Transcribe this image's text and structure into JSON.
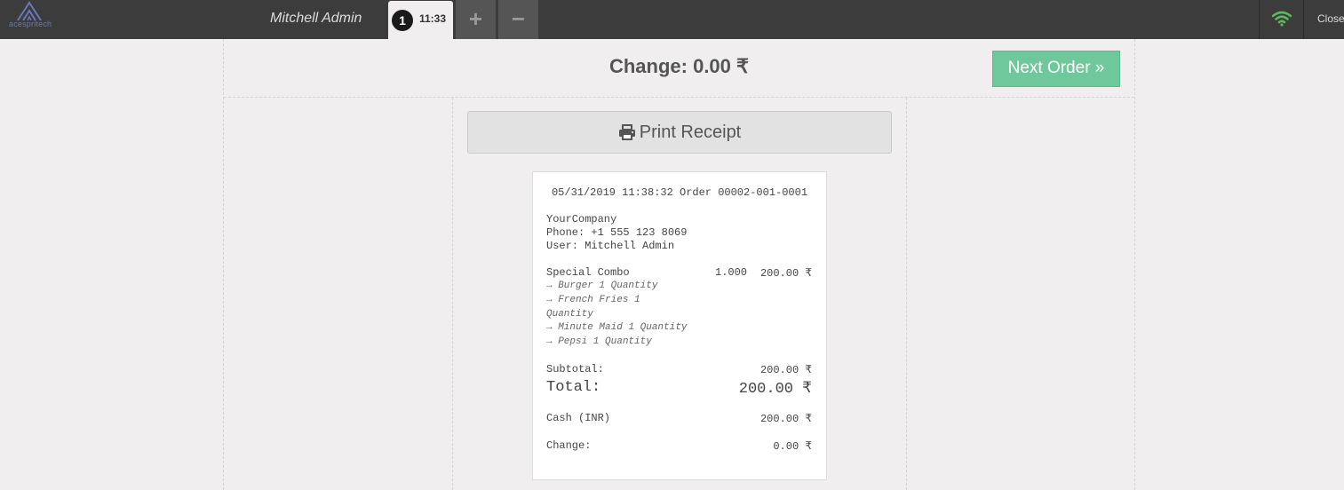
{
  "header": {
    "logo_text": "acespritech",
    "user_name": "Mitchell Admin",
    "order_tab": {
      "number": "1",
      "time": "11:33"
    },
    "add_order_label": "+",
    "remove_order_label": "−",
    "close_label": "Close",
    "wifi_icon": "wifi-icon",
    "wifi_color": "#5cb85c"
  },
  "screen": {
    "change_title": "Change: 0.00 ₹",
    "next_order_label": "Next Order »",
    "print_label": "Print Receipt",
    "print_icon": "printer-icon"
  },
  "receipt": {
    "header_line": "05/31/2019 11:38:32 Order 00002-001-0001",
    "company": "YourCompany",
    "phone": "Phone: +1 555 123 8069",
    "user": "User: Mitchell Admin",
    "line_item": {
      "name": "Special Combo",
      "qty": "1.000",
      "price": "200.00 ₹",
      "options": [
        "→ Burger 1 Quantity",
        "→ French Fries 1",
        "Quantity",
        "→ Minute Maid 1 Quantity",
        "→ Pepsi 1 Quantity"
      ]
    },
    "subtotal_label": "Subtotal:",
    "subtotal_value": "200.00 ₹",
    "total_label": "Total:",
    "total_value": "200.00 ₹",
    "payment_label": "Cash (INR)",
    "payment_value": "200.00 ₹",
    "change_label": "Change:",
    "change_value": "0.00 ₹"
  },
  "colors": {
    "topbar": "#3c3c3c",
    "background": "#f0eeee",
    "next_order": "#6ec89b"
  }
}
